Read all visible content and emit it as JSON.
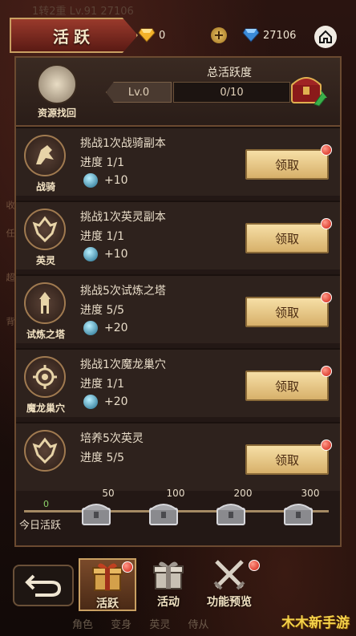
{
  "background": {
    "top_ghost_text": "1转2重  Lv.91            27106",
    "side_ghost": [
      "收",
      "任",
      "超",
      "背"
    ],
    "bottom_ghost": [
      "角色",
      "变身",
      "英灵",
      "侍从"
    ]
  },
  "header": {
    "title": "活跃",
    "gold_gems": "0",
    "blue_gems": "27106"
  },
  "summary": {
    "retrieve_label": "资源找回",
    "total_title": "总活跃度",
    "level": "Lv.0",
    "progress": "0/10"
  },
  "tasks": [
    {
      "icon_label": "战骑",
      "title": "挑战1次战骑副本",
      "progress": "进度 1/1",
      "reward": "+10",
      "button": "领取"
    },
    {
      "icon_label": "英灵",
      "title": "挑战1次英灵副本",
      "progress": "进度 1/1",
      "reward": "+10",
      "button": "领取"
    },
    {
      "icon_label": "试炼之塔",
      "title": "挑战5次试炼之塔",
      "progress": "进度 5/5",
      "reward": "+20",
      "button": "领取"
    },
    {
      "icon_label": "魔龙巢穴",
      "title": "挑战1次魔龙巢穴",
      "progress": "进度 1/1",
      "reward": "+20",
      "button": "领取"
    },
    {
      "icon_label": "",
      "title": "培养5次英灵",
      "progress": "进度 5/5",
      "reward": "",
      "button": "领取"
    }
  ],
  "daily_track": {
    "label": "今日活跃",
    "start": "0",
    "milestones": [
      "50",
      "100",
      "200",
      "300"
    ]
  },
  "bottom_nav": {
    "items": [
      {
        "label": "活跃"
      },
      {
        "label": "活动"
      },
      {
        "label": "功能预览"
      }
    ]
  },
  "watermark": "木木新手游",
  "colors": {
    "accent_gold": "#c9a062",
    "button_bg": "#f6dfa6",
    "notify_red": "#d01e10"
  }
}
